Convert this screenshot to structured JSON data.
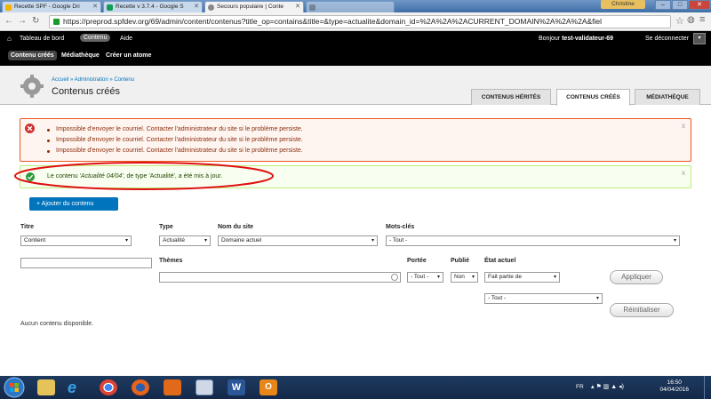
{
  "browser": {
    "tabs": [
      {
        "label": "Recette SPF - Google Dri",
        "color": "#f4b400"
      },
      {
        "label": "Recette v 3.7.4 - Google S",
        "color": "#0f9d58"
      },
      {
        "label": "Secours populaire | Conte",
        "color": "#888888"
      },
      {
        "label": "",
        "color": "#888888"
      }
    ],
    "user_label": "Christine",
    "url": "https://preprod.spfdev.org/69/admin/content/contenus?title_op=contains&title=&type=actualite&domain_id=%2A%2A%2ACURRENT_DOMAIN%2A%2A%2A&fiel",
    "win_controls": [
      "–",
      "□",
      "✕"
    ]
  },
  "toolbar": {
    "dashboard": "Tableau de bord",
    "content": "Contenu",
    "help": "Aide",
    "greeting": "Bonjour",
    "username": "test-validateur-69",
    "logout": "Se déconnecter",
    "sub_items": [
      "Contenu créés",
      "Médiathèque",
      "Créer un atome"
    ]
  },
  "header": {
    "breadcrumb": "Accueil » Administration » Contenu",
    "title": "Contenus créés",
    "tabs": [
      "CONTENUS HÉRITÉS",
      "CONTENUS CRÉÉS",
      "MÉDIATHÈQUE"
    ]
  },
  "messages": {
    "errors": [
      "Impossible d'envoyer le courriel. Contacter l'administrateur du site si le problème persiste.",
      "Impossible d'envoyer le courriel. Contacter l'administrateur du site si le problème persiste.",
      "Impossible d'envoyer le courriel. Contacter l'administrateur du site si le problème persiste."
    ],
    "status_prefix": "Le contenu ",
    "status_title": "'Actualité 04/04'",
    "status_suffix": ", de type 'Actualité', a été mis à jour.",
    "close": "x"
  },
  "add_button": "+ Ajouter du contenu",
  "filters": {
    "titre_label": "Titre",
    "titre_op": "Contient",
    "titre_value": "",
    "type_label": "Type",
    "type_value": "Actualité",
    "site_label": "Nom du site",
    "site_value": "Domaine actuel",
    "tags_label": "Mots-clés",
    "tags_value": "- Tout -",
    "themes_label": "Thèmes",
    "themes_value": "",
    "portee_label": "Portée",
    "portee_value": "- Tout -",
    "publie_label": "Publié",
    "publie_value": "Non",
    "etat_label": "État actuel",
    "etat_op": "Fait partie de",
    "etat_value": "- Tout -",
    "apply": "Appliquer",
    "reset": "Réinitialiser"
  },
  "empty_text": "Aucun contenu disponible.",
  "taskbar": {
    "lang": "FR",
    "time": "16:50",
    "date": "04/04/2016"
  }
}
